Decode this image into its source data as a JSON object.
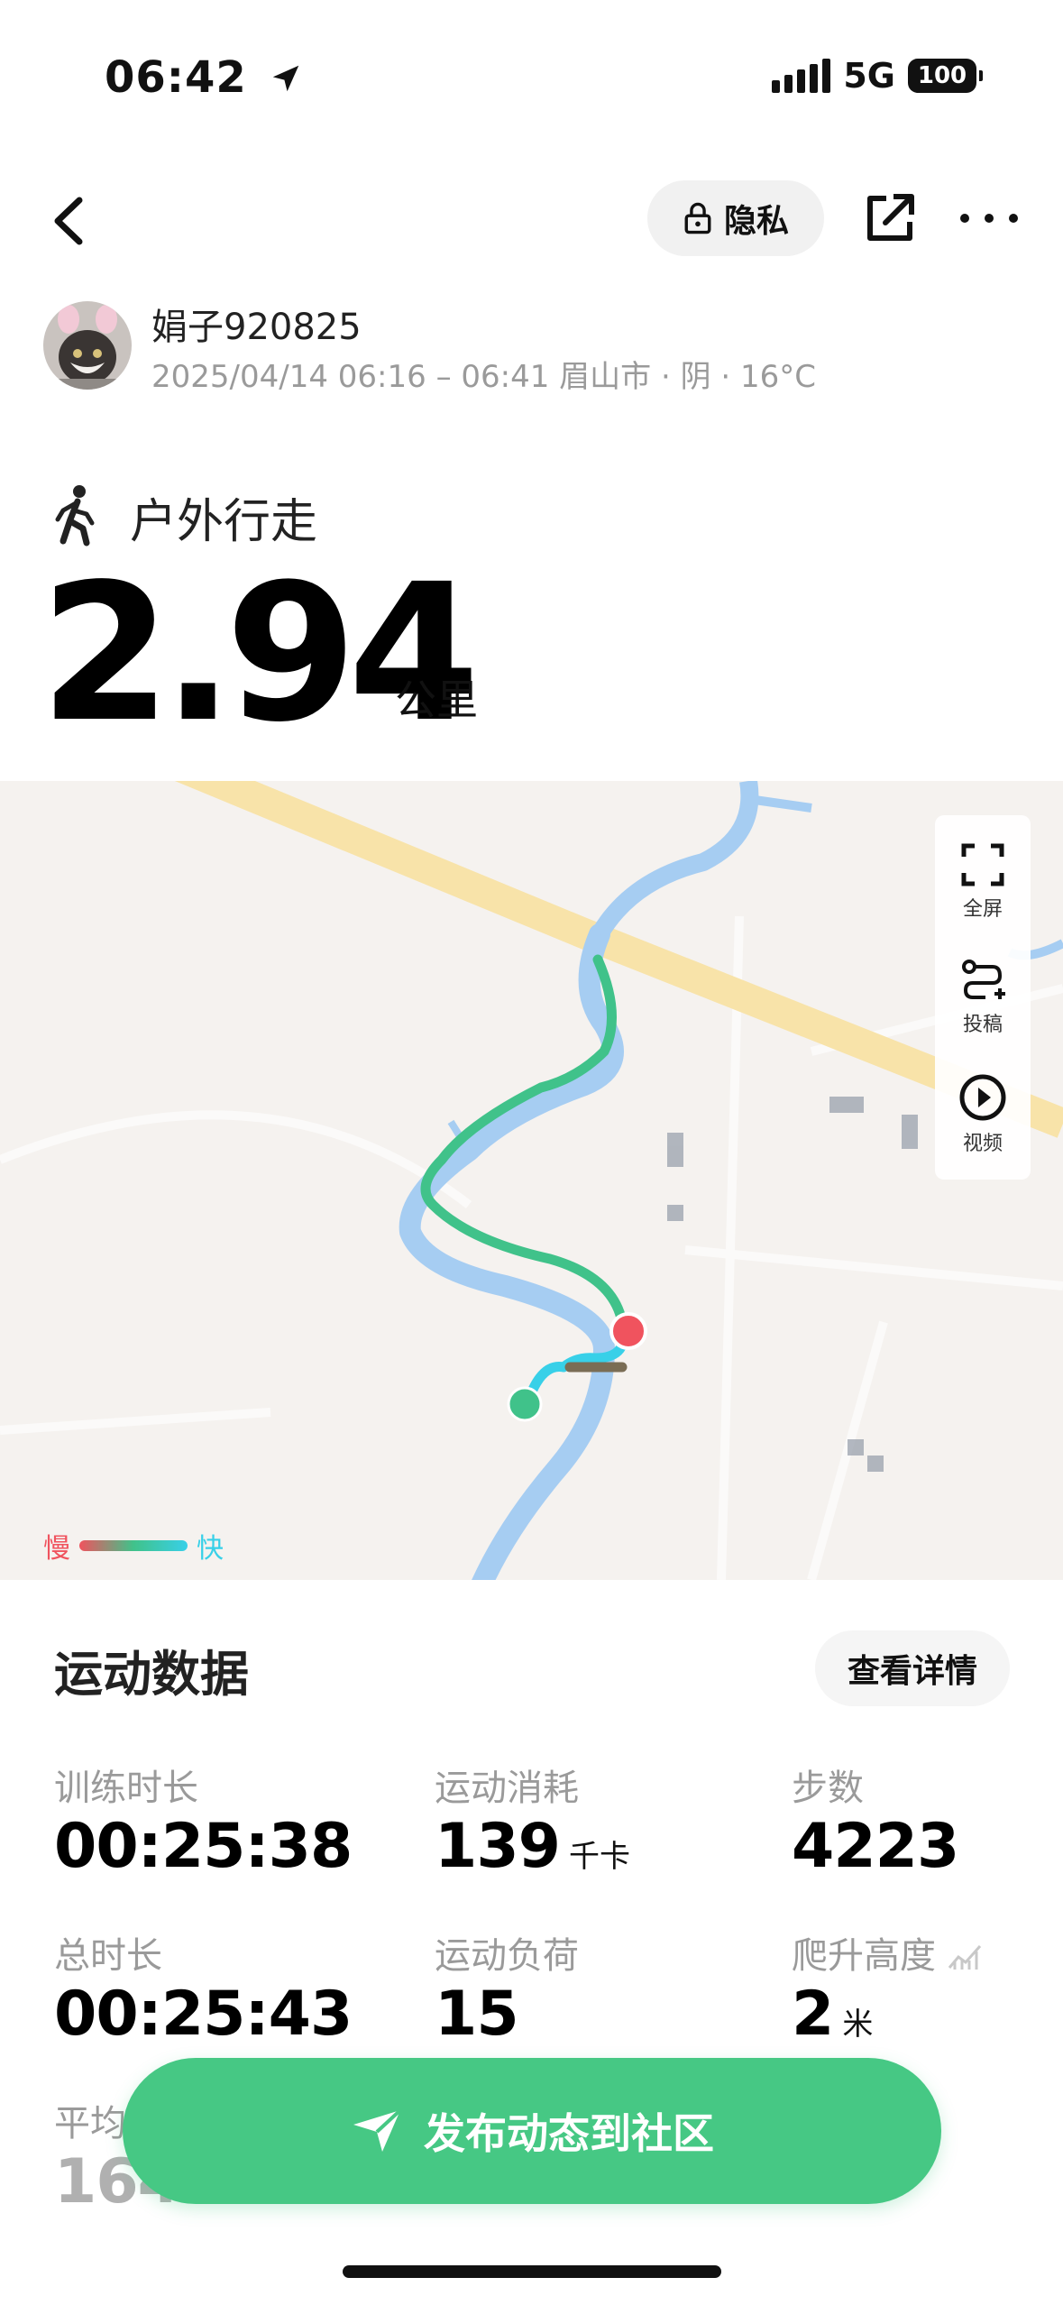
{
  "status_bar": {
    "time": "06:42",
    "network": "5G",
    "battery": "100"
  },
  "header": {
    "privacy_label": "隐私"
  },
  "user": {
    "name": "娟子920825",
    "meta": "2025/04/14 06:16 – 06:41 眉山市 · 阴 · 16°C"
  },
  "activity": {
    "type": "户外行走",
    "distance": "2.94",
    "distance_unit": "公里"
  },
  "map": {
    "tools": [
      {
        "label": "全屏",
        "icon": "fullscreen-icon"
      },
      {
        "label": "投稿",
        "icon": "route-submit-icon"
      },
      {
        "label": "视频",
        "icon": "play-video-icon"
      }
    ],
    "legend": {
      "slow": "慢",
      "fast": "快"
    },
    "colors": {
      "slow": "#f0535e",
      "mid": "#40c28a",
      "fast": "#38d0e8",
      "river": "#a6cdf2",
      "road": "#fce3a0"
    }
  },
  "stats": {
    "title": "运动数据",
    "detail_button": "查看详情",
    "items": [
      {
        "label": "训练时长",
        "value": "00:25:38",
        "unit": ""
      },
      {
        "label": "运动消耗",
        "value": "139",
        "unit": "千卡"
      },
      {
        "label": "步数",
        "value": "4223",
        "unit": ""
      },
      {
        "label": "总时长",
        "value": "00:25:43",
        "unit": ""
      },
      {
        "label": "运动负荷",
        "value": "15",
        "unit": ""
      },
      {
        "label": "爬升高度",
        "value": "2",
        "unit": "米"
      },
      {
        "label": "平均",
        "value": "164",
        "unit": ""
      }
    ]
  },
  "publish": {
    "label": "发布动态到社区",
    "color": "#46c884"
  }
}
